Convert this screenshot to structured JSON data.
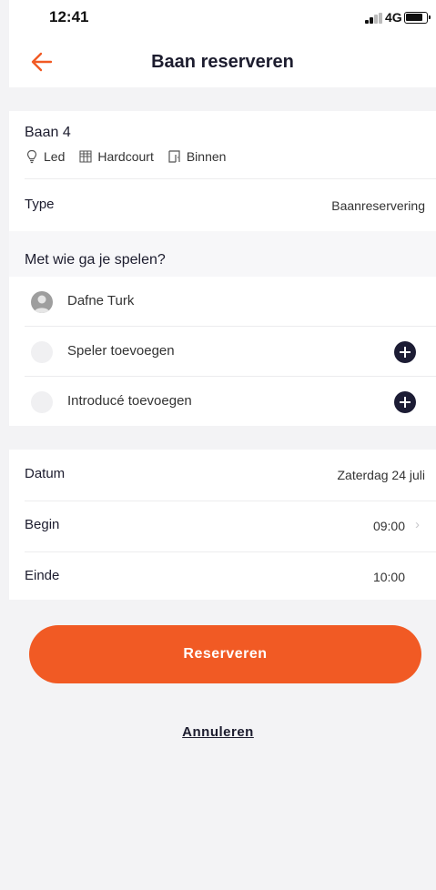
{
  "status_bar": {
    "time": "12:41",
    "network": "4G"
  },
  "header": {
    "title": "Baan reserveren"
  },
  "court": {
    "name": "Baan 4",
    "features": [
      {
        "icon": "bulb-icon",
        "label": "Led"
      },
      {
        "icon": "court-surface-icon",
        "label": "Hardcourt"
      },
      {
        "icon": "door-icon",
        "label": "Binnen"
      }
    ]
  },
  "type": {
    "label": "Type",
    "value": "Baanreservering"
  },
  "players": {
    "heading": "Met wie ga je spelen?",
    "items": [
      {
        "name": "Dafne Turk"
      },
      {
        "name": "Speler toevoegen"
      },
      {
        "name": "Introducé toevoegen"
      }
    ]
  },
  "schedule": {
    "date_label": "Datum",
    "date_value": "Zaterdag 24 juli",
    "begin_label": "Begin",
    "begin_value": "09:00",
    "end_label": "Einde",
    "end_value": "10:00"
  },
  "actions": {
    "reserve": "Reserveren",
    "cancel": "Annuleren"
  },
  "colors": {
    "accent": "#f15a24",
    "dark": "#1c1c34"
  }
}
